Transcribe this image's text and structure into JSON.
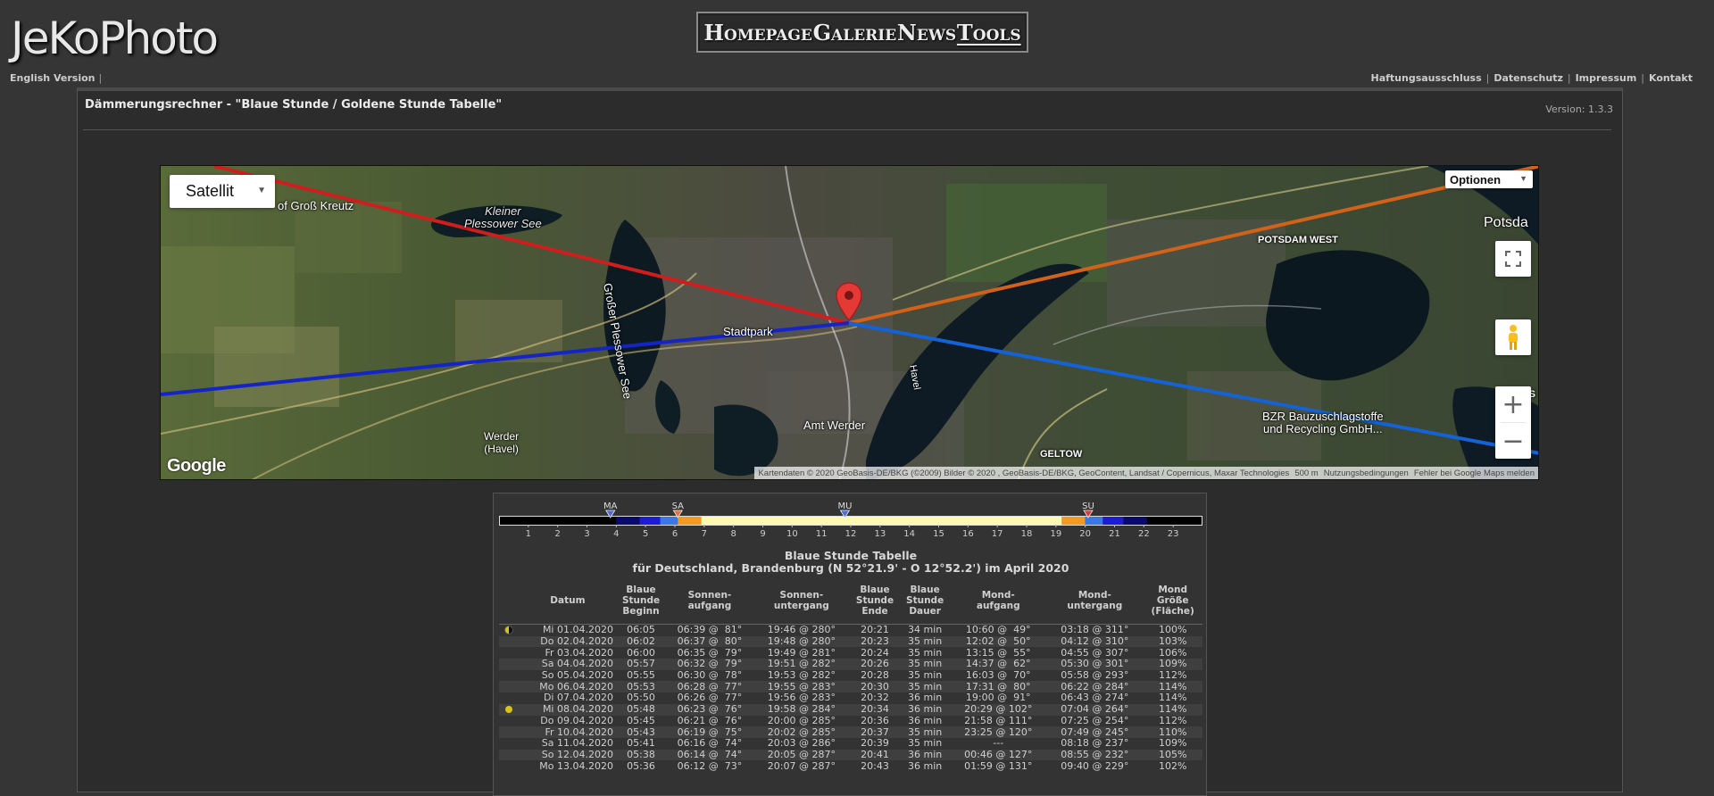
{
  "site": {
    "logo": "JeKoPhoto",
    "nav": [
      "Homepage",
      "Galerie",
      "News",
      "Tools"
    ],
    "active_nav": "Tools",
    "language_link": "English Version",
    "language_sep": "|",
    "legal_links": [
      "Haftungsausschluss",
      "Datenschutz",
      "Impressum",
      "Kontakt"
    ],
    "legal_sep": "|"
  },
  "page": {
    "title": "Dämmerungsrechner - \"Blaue Stunde / Goldene Stunde Tabelle\"",
    "version": "Version: 1.3.3"
  },
  "map": {
    "type_select": "Satellit",
    "options_select": "Optionen",
    "brand": "Google",
    "attribution": "Kartendaten © 2020 GeoBasis-DE/BKG (©2009) Bilder © 2020 , GeoBasis-DE/BKG, GeoContent, Landsat / Copernicus, Maxar Technologies",
    "scale": "500 m",
    "terms": "Nutzungsbedingungen",
    "report": "Fehler bei Google Maps melden",
    "labels": [
      "Kleiner Plessower See",
      "Großer Plessower See",
      "Stadtpark",
      "Amt Werder",
      "Werder (Havel)",
      "GELTOW",
      "POTSDAM WEST",
      "Potsda",
      "BZR Bauzuschlagstoffe und Recycling GmbH...",
      "Havel",
      "of Groß Kreutz",
      "POTS"
    ],
    "colors": {
      "sunrise": "#d01d1d",
      "sunset": "#d2621a",
      "moonrise": "#1424c8",
      "moonset": "#1462d8",
      "marker": "#e53935"
    }
  },
  "timebar": {
    "markers": [
      {
        "label": "MA",
        "hour": 3.8,
        "color": "#4a6bd8"
      },
      {
        "label": "SA",
        "hour": 6.1,
        "color": "#e0733a"
      },
      {
        "label": "MU",
        "hour": 11.8,
        "color": "#4a6bd8"
      },
      {
        "label": "SU",
        "hour": 20.1,
        "color": "#d83a3a"
      }
    ],
    "hours": [
      "1",
      "2",
      "3",
      "4",
      "5",
      "6",
      "7",
      "8",
      "9",
      "10",
      "11",
      "12",
      "13",
      "14",
      "15",
      "16",
      "17",
      "18",
      "19",
      "20",
      "21",
      "22",
      "23"
    ],
    "segments": [
      {
        "from": 0,
        "to": 4.0,
        "color": "#000000"
      },
      {
        "from": 4.0,
        "to": 4.8,
        "color": "#0a0a6e"
      },
      {
        "from": 4.8,
        "to": 5.5,
        "color": "#1c1cd6"
      },
      {
        "from": 5.5,
        "to": 6.1,
        "color": "#3a78e8"
      },
      {
        "from": 6.1,
        "to": 6.9,
        "color": "#f39a1e"
      },
      {
        "from": 6.9,
        "to": 19.2,
        "color": "#fff8b0"
      },
      {
        "from": 19.2,
        "to": 20.0,
        "color": "#f39a1e"
      },
      {
        "from": 20.0,
        "to": 20.6,
        "color": "#3a78e8"
      },
      {
        "from": 20.6,
        "to": 21.3,
        "color": "#1c1cd6"
      },
      {
        "from": 21.3,
        "to": 22.1,
        "color": "#0a0a6e"
      },
      {
        "from": 22.1,
        "to": 24,
        "color": "#000000"
      }
    ]
  },
  "table": {
    "title": "Blaue Stunde Tabelle",
    "subtitle": "für Deutschland, Brandenburg (N 52°21.9' - O 12°52.2') im April 2020",
    "headers": [
      "Datum",
      "Blaue Stunde Beginn",
      "Sonnen- aufgang",
      "Sonnen- untergang",
      "Blaue Stunde Ende",
      "Blaue Stunde Dauer",
      "Mond- aufgang",
      "Mond- untergang",
      "Mond Größe (Fläche)"
    ],
    "rows": [
      {
        "moon": "half",
        "date": "Mi 01.04.2020",
        "bsb": "06:05",
        "sa": "06:39 @  81°",
        "su": "19:46 @ 280°",
        "bse": "20:21",
        "dur": "34 min",
        "ma": "10:60 @  49°",
        "mu": "03:18 @ 311°",
        "size": "100%"
      },
      {
        "moon": "",
        "date": "Do 02.04.2020",
        "bsb": "06:02",
        "sa": "06:37 @  80°",
        "su": "19:48 @ 280°",
        "bse": "20:23",
        "dur": "35 min",
        "ma": "12:02 @  50°",
        "mu": "04:12 @ 310°",
        "size": "103%"
      },
      {
        "moon": "",
        "date": "Fr 03.04.2020",
        "bsb": "06:00",
        "sa": "06:35 @  79°",
        "su": "19:49 @ 281°",
        "bse": "20:24",
        "dur": "35 min",
        "ma": "13:15 @  55°",
        "mu": "04:55 @ 307°",
        "size": "106%"
      },
      {
        "moon": "",
        "date": "Sa 04.04.2020",
        "bsb": "05:57",
        "sa": "06:32 @  79°",
        "su": "19:51 @ 282°",
        "bse": "20:26",
        "dur": "35 min",
        "ma": "14:37 @  62°",
        "mu": "05:30 @ 301°",
        "size": "109%"
      },
      {
        "moon": "",
        "date": "So 05.04.2020",
        "bsb": "05:55",
        "sa": "06:30 @  78°",
        "su": "19:53 @ 282°",
        "bse": "20:28",
        "dur": "35 min",
        "ma": "16:03 @  70°",
        "mu": "05:58 @ 293°",
        "size": "112%"
      },
      {
        "moon": "",
        "date": "Mo 06.04.2020",
        "bsb": "05:53",
        "sa": "06:28 @  77°",
        "su": "19:55 @ 283°",
        "bse": "20:30",
        "dur": "35 min",
        "ma": "17:31 @  80°",
        "mu": "06:22 @ 284°",
        "size": "114%"
      },
      {
        "moon": "",
        "date": "Di 07.04.2020",
        "bsb": "05:50",
        "sa": "06:26 @  77°",
        "su": "19:56 @ 283°",
        "bse": "20:32",
        "dur": "36 min",
        "ma": "19:00 @  91°",
        "mu": "06:43 @ 274°",
        "size": "114%"
      },
      {
        "moon": "full",
        "date": "Mi 08.04.2020",
        "bsb": "05:48",
        "sa": "06:23 @  76°",
        "su": "19:58 @ 284°",
        "bse": "20:34",
        "dur": "36 min",
        "ma": "20:29 @ 102°",
        "mu": "07:04 @ 264°",
        "size": "114%"
      },
      {
        "moon": "",
        "date": "Do 09.04.2020",
        "bsb": "05:45",
        "sa": "06:21 @  76°",
        "su": "20:00 @ 285°",
        "bse": "20:36",
        "dur": "36 min",
        "ma": "21:58 @ 111°",
        "mu": "07:25 @ 254°",
        "size": "112%"
      },
      {
        "moon": "",
        "date": "Fr 10.04.2020",
        "bsb": "05:43",
        "sa": "06:19 @  75°",
        "su": "20:02 @ 285°",
        "bse": "20:37",
        "dur": "35 min",
        "ma": "23:25 @ 120°",
        "mu": "07:49 @ 245°",
        "size": "110%"
      },
      {
        "moon": "",
        "date": "Sa 11.04.2020",
        "bsb": "05:41",
        "sa": "06:16 @  74°",
        "su": "20:03 @ 286°",
        "bse": "20:39",
        "dur": "35 min",
        "ma": "---",
        "mu": "08:18 @ 237°",
        "size": "109%"
      },
      {
        "moon": "",
        "date": "So 12.04.2020",
        "bsb": "05:38",
        "sa": "06:14 @  74°",
        "su": "20:05 @ 287°",
        "bse": "20:41",
        "dur": "36 min",
        "ma": "00:46 @ 127°",
        "mu": "08:55 @ 232°",
        "size": "105%"
      },
      {
        "moon": "",
        "date": "Mo 13.04.2020",
        "bsb": "05:36",
        "sa": "06:12 @  73°",
        "su": "20:07 @ 287°",
        "bse": "20:43",
        "dur": "36 min",
        "ma": "01:59 @ 131°",
        "mu": "09:40 @ 229°",
        "size": "102%"
      }
    ]
  }
}
